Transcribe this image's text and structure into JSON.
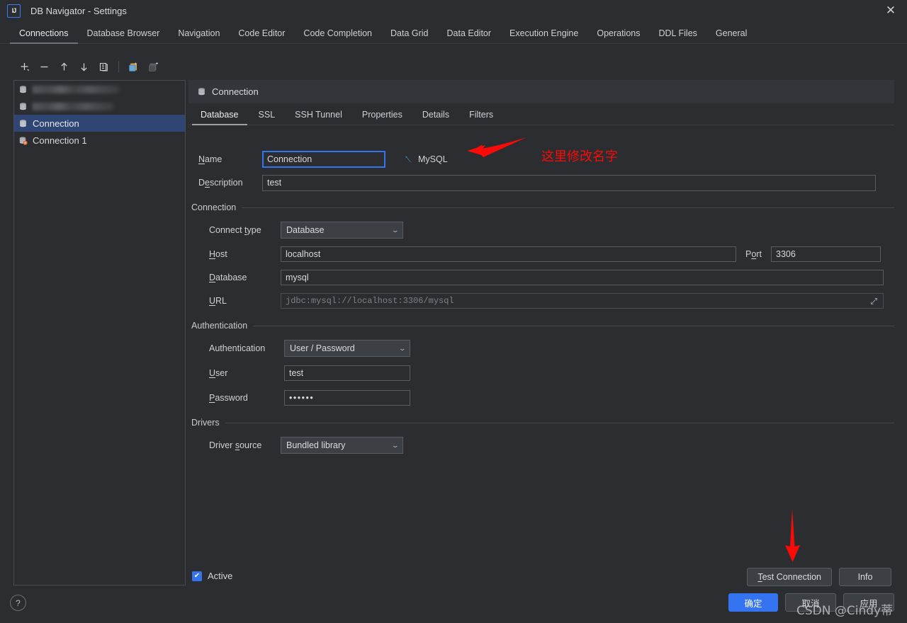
{
  "window": {
    "title": "DB Navigator - Settings",
    "logo_text": "IJ",
    "close_label": "✕"
  },
  "top_tabs": [
    {
      "label": "Connections",
      "active": true
    },
    {
      "label": "Database Browser",
      "active": false
    },
    {
      "label": "Navigation",
      "active": false
    },
    {
      "label": "Code Editor",
      "active": false
    },
    {
      "label": "Code Completion",
      "active": false
    },
    {
      "label": "Data Grid",
      "active": false
    },
    {
      "label": "Data Editor",
      "active": false
    },
    {
      "label": "Execution Engine",
      "active": false
    },
    {
      "label": "Operations",
      "active": false
    },
    {
      "label": "DDL Files",
      "active": false
    },
    {
      "label": "General",
      "active": false
    }
  ],
  "sidebar": {
    "toolbar": [
      {
        "name": "add-connection-button",
        "glyph": "+"
      },
      {
        "name": "remove-connection-button",
        "glyph": "−"
      },
      {
        "name": "move-up-button",
        "glyph": "↑"
      },
      {
        "name": "move-down-button",
        "glyph": "↓"
      },
      {
        "name": "duplicate-button",
        "glyph": "❐"
      },
      {
        "name": "copy-button",
        "glyph": "copy"
      },
      {
        "name": "paste-button",
        "glyph": "paste"
      }
    ],
    "items": [
      {
        "label": "",
        "blurred": true,
        "selected": false,
        "error": false
      },
      {
        "label": "",
        "blurred": true,
        "selected": false,
        "error": false
      },
      {
        "label": "Connection",
        "blurred": false,
        "selected": true,
        "error": false
      },
      {
        "label": "Connection 1",
        "blurred": false,
        "selected": false,
        "error": true
      }
    ]
  },
  "panel": {
    "header_title": "Connection",
    "tabs": [
      {
        "label": "Database",
        "active": true
      },
      {
        "label": "SSL",
        "active": false
      },
      {
        "label": "SSH Tunnel",
        "active": false
      },
      {
        "label": "Properties",
        "active": false
      },
      {
        "label": "Details",
        "active": false
      },
      {
        "label": "Filters",
        "active": false
      }
    ]
  },
  "form": {
    "name_label": "Name",
    "name_value": "Connection",
    "db_type_label": "MySQL",
    "description_label": "Description",
    "description_value": "test",
    "connection_group": "Connection",
    "connect_type_label": "Connect type",
    "connect_type_value": "Database",
    "host_label": "Host",
    "host_value": "localhost",
    "port_label": "Port",
    "port_value": "3306",
    "database_label": "Database",
    "database_value": "mysql",
    "url_label": "URL",
    "url_value": "jdbc:mysql://localhost:3306/mysql",
    "authentication_group": "Authentication",
    "authentication_label": "Authentication",
    "authentication_value": "User / Password",
    "user_label": "User",
    "user_value": "test",
    "password_label": "Password",
    "password_value": "••••••",
    "drivers_group": "Drivers",
    "driver_source_label": "Driver source",
    "driver_source_value": "Bundled library",
    "active_label": "Active",
    "active_checked": true,
    "check_glyph": "✔"
  },
  "footer": {
    "test_connection_label": "Test Connection",
    "info_label": "Info",
    "ok_label": "确定",
    "cancel_label": "取消",
    "apply_label": "应用",
    "help_label": "?"
  },
  "annotations": {
    "name_note": "这里修改名字",
    "watermark": "CSDN @Cindy蒂",
    "arrow_color": "#fb0b08"
  }
}
